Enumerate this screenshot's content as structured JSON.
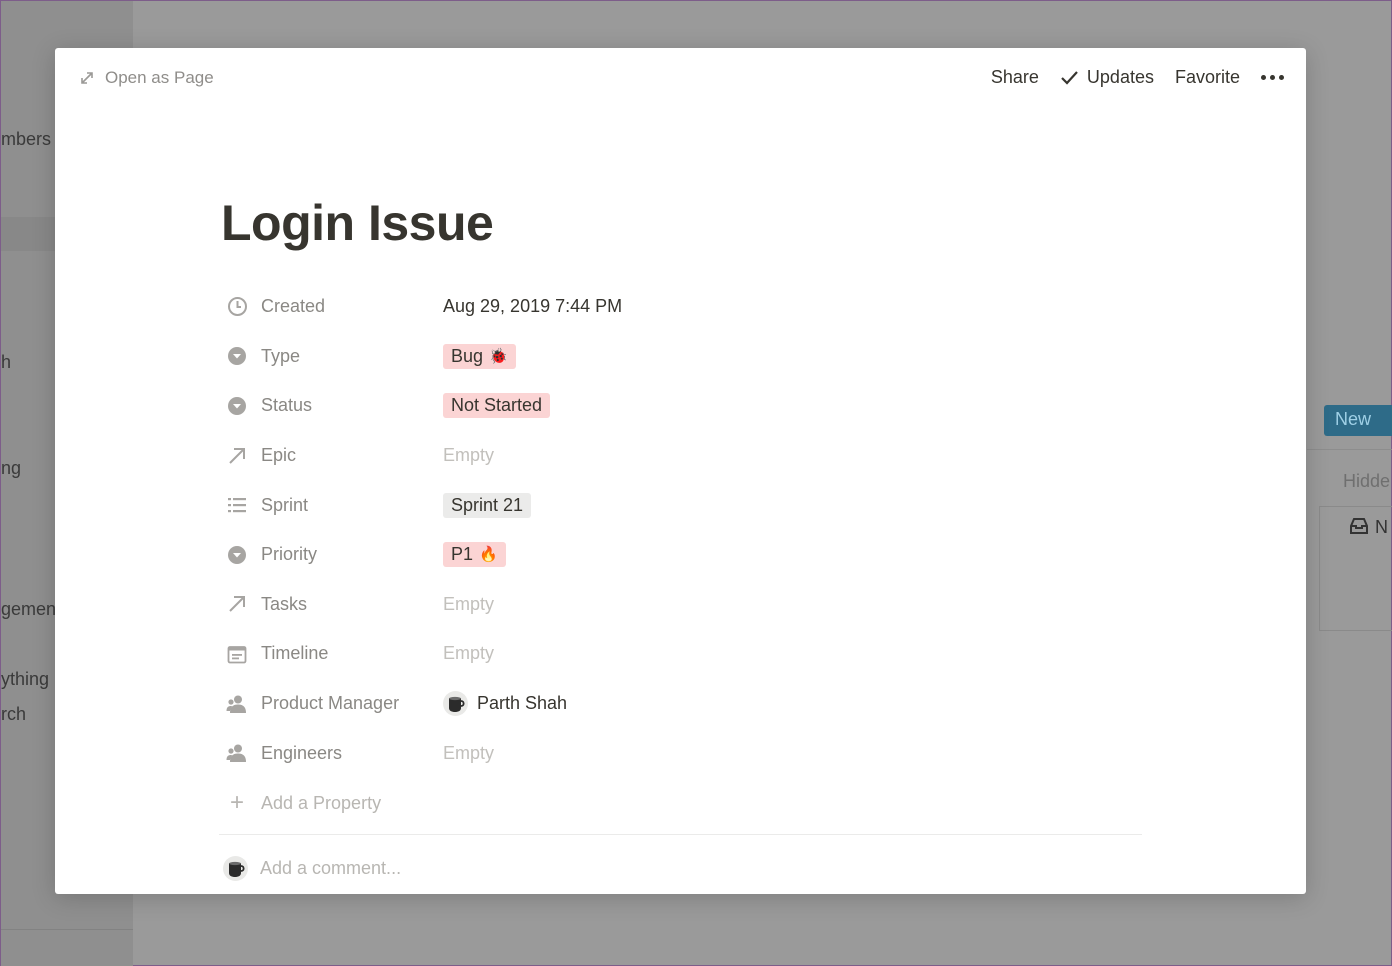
{
  "background": {
    "sidebar_fragments": [
      "mbers",
      "h",
      "ng",
      "gemen",
      "ything",
      "rch"
    ],
    "new_button": "New",
    "hidden_label": "Hidde",
    "card_fragment": "N"
  },
  "topbar": {
    "open_as_page": "Open as Page",
    "share": "Share",
    "updates": "Updates",
    "favorite": "Favorite"
  },
  "page": {
    "title": "Login Issue"
  },
  "properties": [
    {
      "label": "Created",
      "icon": "clock-icon",
      "value": "Aug 29, 2019 7:44 PM",
      "kind": "text"
    },
    {
      "label": "Type",
      "icon": "select-icon",
      "value": "Bug",
      "emoji": "🐞",
      "kind": "tag-red"
    },
    {
      "label": "Status",
      "icon": "select-icon",
      "value": "Not Started",
      "kind": "tag-red"
    },
    {
      "label": "Epic",
      "icon": "relation-arrow-icon",
      "value": "Empty",
      "kind": "empty"
    },
    {
      "label": "Sprint",
      "icon": "list-icon",
      "value": "Sprint 21",
      "kind": "tag-gray"
    },
    {
      "label": "Priority",
      "icon": "select-icon",
      "value": "P1",
      "emoji": "🔥",
      "kind": "tag-red"
    },
    {
      "label": "Tasks",
      "icon": "relation-arrow-icon",
      "value": "Empty",
      "kind": "empty"
    },
    {
      "label": "Timeline",
      "icon": "calendar-icon",
      "value": "Empty",
      "kind": "empty"
    },
    {
      "label": "Product Manager",
      "icon": "person-icon",
      "value": "Parth Shah",
      "kind": "person"
    },
    {
      "label": "Engineers",
      "icon": "person-icon",
      "value": "Empty",
      "kind": "empty"
    }
  ],
  "add_property": "Add a Property",
  "comment_placeholder": "Add a comment...",
  "colors": {
    "tag_red": "#fbd4d4",
    "tag_gray": "#ebebea",
    "text": "#37352f",
    "muted": "#8a8884"
  }
}
